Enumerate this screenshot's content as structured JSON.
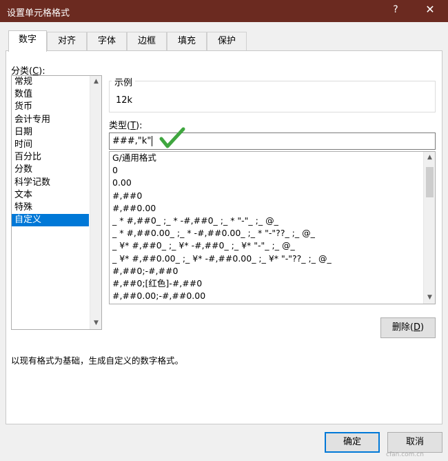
{
  "window": {
    "title": "设置单元格格式",
    "help_label": "?",
    "close_label": "✕",
    "titlebar_color": "#6b2a20"
  },
  "tabs": [
    {
      "label": "数字",
      "active": true
    },
    {
      "label": "对齐"
    },
    {
      "label": "字体"
    },
    {
      "label": "边框"
    },
    {
      "label": "填充"
    },
    {
      "label": "保护"
    }
  ],
  "category": {
    "label_text": "分类(",
    "label_key": "C",
    "label_end": "):",
    "items": [
      "常规",
      "数值",
      "货币",
      "会计专用",
      "日期",
      "时间",
      "百分比",
      "分数",
      "科学记数",
      "文本",
      "特殊",
      "自定义"
    ],
    "selected": "自定义"
  },
  "sample": {
    "legend": "示例",
    "value": "12k"
  },
  "type": {
    "label_text": "类型(",
    "label_key": "T",
    "label_end": "):",
    "value": "###,\"k\""
  },
  "format_list": {
    "items": [
      "G/通用格式",
      "0",
      "0.00",
      "#,##0",
      "#,##0.00",
      "_ * #,##0_ ;_ * -#,##0_ ;_ * \"-\"_ ;_ @_",
      "_ * #,##0.00_ ;_ * -#,##0.00_ ;_ * \"-\"??_ ;_ @_",
      "_ ¥* #,##0_ ;_ ¥* -#,##0_ ;_ ¥* \"-\"_ ;_ @_",
      "_ ¥* #,##0.00_ ;_ ¥* -#,##0.00_ ;_ ¥* \"-\"??_ ;_ @_",
      "#,##0;-#,##0",
      "#,##0;[红色]-#,##0",
      "#,##0.00;-#,##0.00"
    ]
  },
  "buttons": {
    "delete_text": "删除(",
    "delete_key": "D",
    "delete_end": ")",
    "ok": "确定",
    "cancel": "取消"
  },
  "description": "以现有格式为基础，生成自定义的数字格式。",
  "watermark": "cfan.com.cn",
  "colors": {
    "selection": "#0078d7",
    "check": "#3fa63f"
  }
}
